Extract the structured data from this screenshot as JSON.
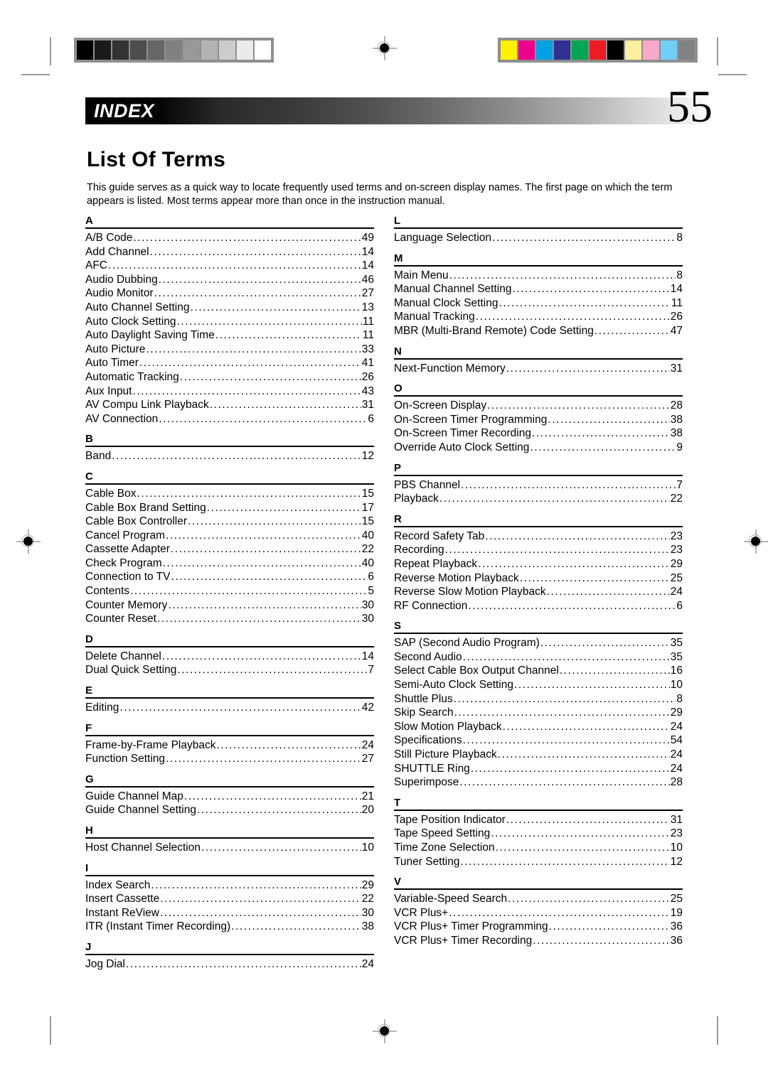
{
  "header": {
    "section_label": "INDEX",
    "page_number": "55",
    "title": "List Of Terms",
    "intro": "This guide serves as a quick way to locate frequently used terms and on-screen display names. The first page on which the term appears is listed. Most terms appear more than once in the instruction manual."
  },
  "calibration": {
    "grayscale_patches": [
      "#000000",
      "#1a1a1a",
      "#333333",
      "#4d4d4d",
      "#666666",
      "#808080",
      "#999999",
      "#b3b3b3",
      "#cccccc",
      "#ebebeb",
      "#ffffff"
    ],
    "color_patches": [
      "#fff200",
      "#ec008c",
      "#00a1e4",
      "#2e3192",
      "#00a651",
      "#ed1c24",
      "#000000",
      "#fbf0a0",
      "#f9a8c8",
      "#6fcff6",
      "#808285"
    ]
  },
  "index": {
    "left_column": [
      {
        "letter": "A",
        "entries": [
          {
            "term": "A/B Code",
            "page": "49"
          },
          {
            "term": "Add Channel",
            "page": "14"
          },
          {
            "term": "AFC",
            "page": "14"
          },
          {
            "term": "Audio Dubbing",
            "page": "46"
          },
          {
            "term": "Audio Monitor",
            "page": "27"
          },
          {
            "term": "Auto Channel Setting",
            "page": "13"
          },
          {
            "term": "Auto Clock Setting",
            "page": "11"
          },
          {
            "term": "Auto Daylight Saving Time",
            "page": "11"
          },
          {
            "term": "Auto Picture",
            "page": "33"
          },
          {
            "term": "Auto Timer",
            "page": "41"
          },
          {
            "term": "Automatic Tracking",
            "page": "26"
          },
          {
            "term": "Aux Input",
            "page": "43"
          },
          {
            "term": "AV Compu Link Playback",
            "page": "31"
          },
          {
            "term": "AV Connection",
            "page": "6"
          }
        ]
      },
      {
        "letter": "B",
        "entries": [
          {
            "term": "Band",
            "page": "12"
          }
        ]
      },
      {
        "letter": "C",
        "entries": [
          {
            "term": "Cable Box",
            "page": "15"
          },
          {
            "term": "Cable Box Brand Setting",
            "page": "17"
          },
          {
            "term": "Cable Box Controller",
            "page": "15"
          },
          {
            "term": "Cancel Program",
            "page": "40"
          },
          {
            "term": "Cassette Adapter",
            "page": "22"
          },
          {
            "term": "Check Program",
            "page": "40"
          },
          {
            "term": "Connection to TV",
            "page": "6"
          },
          {
            "term": "Contents",
            "page": "5"
          },
          {
            "term": "Counter Memory",
            "page": "30"
          },
          {
            "term": "Counter Reset",
            "page": "30"
          }
        ]
      },
      {
        "letter": "D",
        "entries": [
          {
            "term": "Delete Channel",
            "page": "14"
          },
          {
            "term": "Dual Quick Setting",
            "page": "7"
          }
        ]
      },
      {
        "letter": "E",
        "entries": [
          {
            "term": "Editing",
            "page": "42"
          }
        ]
      },
      {
        "letter": "F",
        "entries": [
          {
            "term": "Frame-by-Frame Playback",
            "page": "24"
          },
          {
            "term": "Function Setting",
            "page": "27"
          }
        ]
      },
      {
        "letter": "G",
        "entries": [
          {
            "term": "Guide Channel Map",
            "page": "21"
          },
          {
            "term": "Guide Channel Setting",
            "page": "20"
          }
        ]
      },
      {
        "letter": "H",
        "entries": [
          {
            "term": "Host Channel Selection",
            "page": "10"
          }
        ]
      },
      {
        "letter": "I",
        "entries": [
          {
            "term": "Index Search",
            "page": "29"
          },
          {
            "term": "Insert Cassette",
            "page": "22"
          },
          {
            "term": "Instant ReView",
            "page": "30"
          },
          {
            "term": "ITR (Instant Timer Recording)",
            "page": "38"
          }
        ]
      },
      {
        "letter": "J",
        "entries": [
          {
            "term": "Jog Dial",
            "page": "24"
          }
        ]
      }
    ],
    "right_column": [
      {
        "letter": "L",
        "entries": [
          {
            "term": "Language Selection",
            "page": "8"
          }
        ]
      },
      {
        "letter": "M",
        "entries": [
          {
            "term": "Main Menu",
            "page": "8"
          },
          {
            "term": "Manual Channel Setting",
            "page": "14"
          },
          {
            "term": "Manual Clock Setting",
            "page": "11"
          },
          {
            "term": "Manual Tracking",
            "page": "26"
          },
          {
            "term": "MBR (Multi-Brand Remote) Code Setting",
            "page": "47"
          }
        ]
      },
      {
        "letter": "N",
        "entries": [
          {
            "term": "Next-Function Memory",
            "page": "31"
          }
        ]
      },
      {
        "letter": "O",
        "entries": [
          {
            "term": "On-Screen Display",
            "page": "28"
          },
          {
            "term": "On-Screen Timer Programming",
            "page": "38"
          },
          {
            "term": "On-Screen Timer Recording",
            "page": "38"
          },
          {
            "term": "Override Auto Clock Setting",
            "page": "9"
          }
        ]
      },
      {
        "letter": "P",
        "entries": [
          {
            "term": "PBS Channel",
            "page": "7"
          },
          {
            "term": "Playback",
            "page": "22"
          }
        ]
      },
      {
        "letter": "R",
        "entries": [
          {
            "term": "Record Safety Tab",
            "page": "23"
          },
          {
            "term": "Recording",
            "page": "23"
          },
          {
            "term": "Repeat Playback",
            "page": "29"
          },
          {
            "term": "Reverse Motion Playback",
            "page": "25"
          },
          {
            "term": "Reverse Slow Motion Playback",
            "page": "24"
          },
          {
            "term": "RF Connection",
            "page": "6"
          }
        ]
      },
      {
        "letter": "S",
        "entries": [
          {
            "term": "SAP (Second Audio Program)",
            "page": "35"
          },
          {
            "term": "Second Audio",
            "page": "35"
          },
          {
            "term": "Select Cable Box Output Channel",
            "page": "16"
          },
          {
            "term": "Semi-Auto Clock Setting",
            "page": "10"
          },
          {
            "term": "Shuttle Plus",
            "page": "8"
          },
          {
            "term": "Skip Search",
            "page": "29"
          },
          {
            "term": "Slow Motion Playback",
            "page": "24"
          },
          {
            "term": "Specifications",
            "page": "54"
          },
          {
            "term": "Still Picture Playback",
            "page": "24"
          },
          {
            "term": "SHUTTLE Ring",
            "page": "24"
          },
          {
            "term": "Superimpose",
            "page": "28"
          }
        ]
      },
      {
        "letter": "T",
        "entries": [
          {
            "term": "Tape Position Indicator",
            "page": "31"
          },
          {
            "term": "Tape Speed Setting",
            "page": "23"
          },
          {
            "term": "Time Zone Selection",
            "page": "10"
          },
          {
            "term": "Tuner Setting",
            "page": "12"
          }
        ]
      },
      {
        "letter": "V",
        "entries": [
          {
            "term": "Variable-Speed Search",
            "page": "25"
          },
          {
            "term": "VCR Plus+",
            "page": "19"
          },
          {
            "term": "VCR Plus+ Timer Programming",
            "page": "36"
          },
          {
            "term": "VCR Plus+ Timer Recording",
            "page": "36"
          }
        ]
      }
    ]
  }
}
